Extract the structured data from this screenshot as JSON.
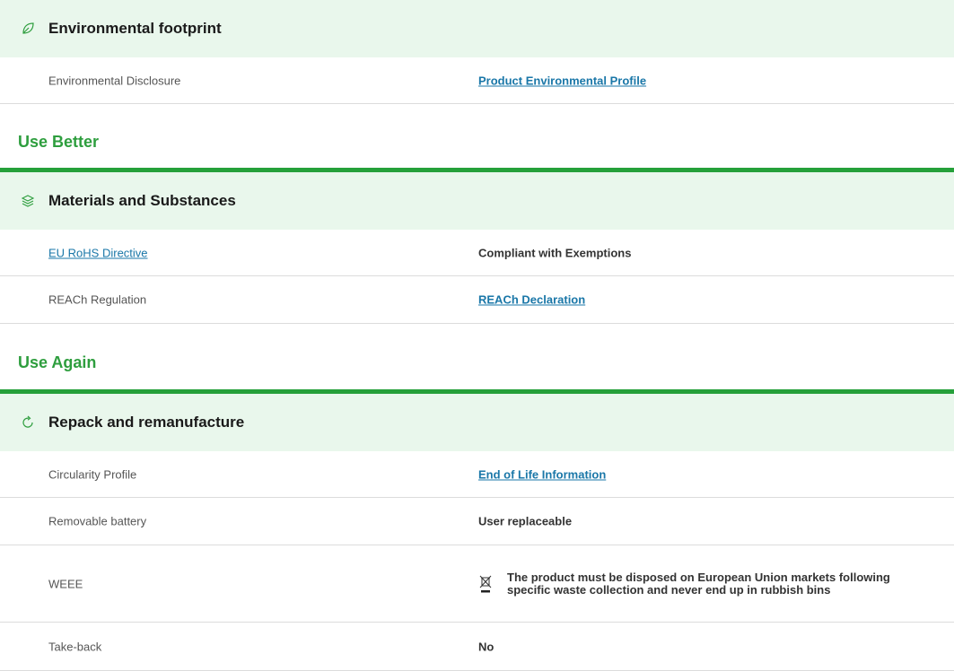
{
  "footprint": {
    "header": {
      "title": "Environmental footprint",
      "icon": "leaf-icon"
    },
    "rows": [
      {
        "label": "Environmental Disclosure",
        "value": "Product Environmental Profile",
        "value_is_link": true
      }
    ]
  },
  "use_better": {
    "section_title": "Use Better",
    "header": {
      "title": "Materials and Substances",
      "icon": "layers-icon"
    },
    "rows": [
      {
        "label": "EU RoHS Directive",
        "label_is_link": true,
        "value": "Compliant with Exemptions"
      },
      {
        "label": "REACh Regulation",
        "value": "REACh Declaration",
        "value_is_link": true
      }
    ]
  },
  "use_again": {
    "section_title": "Use Again",
    "header": {
      "title": "Repack and remanufacture",
      "icon": "refresh-icon"
    },
    "rows": [
      {
        "label": "Circularity Profile",
        "value": "End of Life Information",
        "value_is_link": true
      },
      {
        "label": "Removable battery",
        "value": "User replaceable"
      },
      {
        "label": "WEEE",
        "value": "The product must be disposed on European Union markets following specific waste collection and never end up in rubbish bins",
        "icon": "crossed-bin-icon"
      },
      {
        "label": "Take-back",
        "value": "No"
      }
    ]
  },
  "colors": {
    "accent_green": "#25a03a",
    "header_bg": "#e9f7ec",
    "link_blue": "#1a77a8"
  }
}
